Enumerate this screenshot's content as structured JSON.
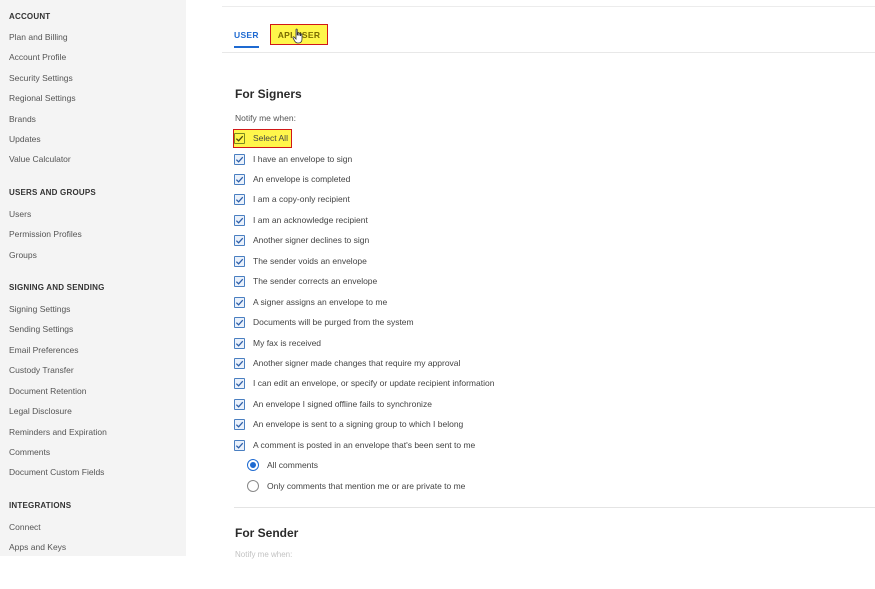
{
  "sidebar": {
    "sections": [
      {
        "title": "ACCOUNT",
        "items": [
          "Plan and Billing",
          "Account Profile",
          "Security Settings",
          "Regional Settings",
          "Brands",
          "Updates",
          "Value Calculator"
        ]
      },
      {
        "title": "USERS AND GROUPS",
        "items": [
          "Users",
          "Permission Profiles",
          "Groups"
        ]
      },
      {
        "title": "SIGNING AND SENDING",
        "items": [
          "Signing Settings",
          "Sending Settings",
          "Email Preferences",
          "Custody Transfer",
          "Document Retention",
          "Legal Disclosure",
          "Reminders and Expiration",
          "Comments",
          "Document Custom Fields"
        ]
      },
      {
        "title": "INTEGRATIONS",
        "items": [
          "Connect",
          "Apps and Keys"
        ]
      }
    ]
  },
  "tabs": {
    "user": "USER",
    "api_user": "API USER"
  },
  "signers": {
    "heading": "For Signers",
    "notify_label": "Notify me when:",
    "select_all": "Select All",
    "options": [
      "I have an envelope to sign",
      "An envelope is completed",
      "I am a copy-only recipient",
      "I am an acknowledge recipient",
      "Another signer declines to sign",
      "The sender voids an envelope",
      "The sender corrects an envelope",
      "A signer assigns an envelope to me",
      "Documents will be purged from the system",
      "My fax is received",
      "Another signer made changes that require my approval",
      "I can edit an envelope, or specify or update recipient information",
      "An envelope I signed offline fails to synchronize",
      "An envelope is sent to a signing group to which I belong",
      "A comment is posted in an envelope that's been sent to me"
    ],
    "comment_options": [
      "All comments",
      "Only comments that mention me or are private to me"
    ],
    "selected_comment_option": "All comments"
  },
  "sender": {
    "heading": "For Sender",
    "notify_label": "Notify me when:"
  },
  "colors": {
    "accent": "#1e6ad1",
    "highlight": "#fff64b",
    "highlight_border": "#d01818"
  }
}
